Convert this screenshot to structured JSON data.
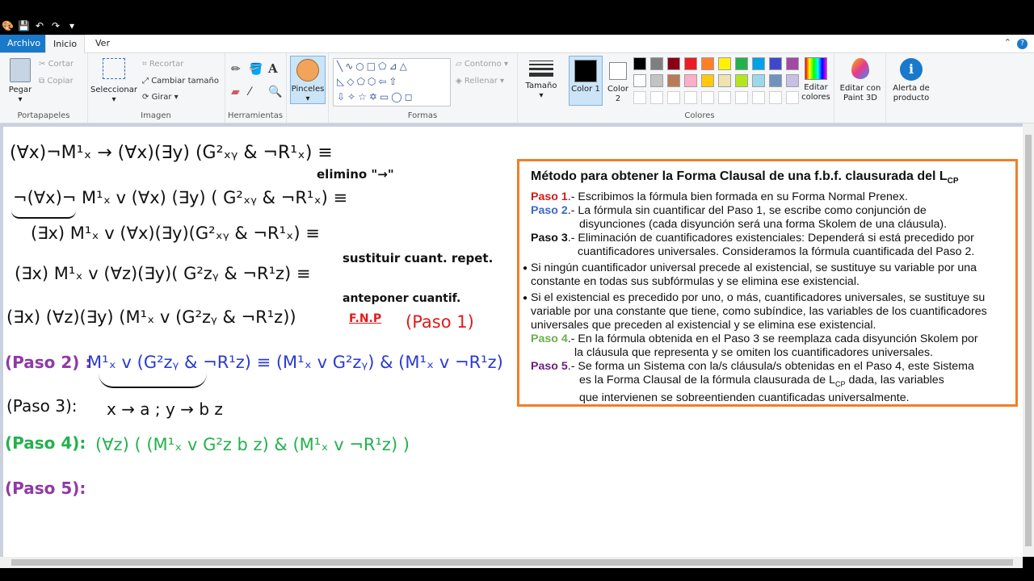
{
  "menu": {
    "file": "Archivo",
    "home": "Inicio",
    "view": "Ver"
  },
  "clipboard": {
    "paste": "Pegar",
    "cut": "Cortar",
    "copy": "Copiar",
    "label": "Portapapeles"
  },
  "image": {
    "select": "Seleccionar",
    "crop": "Recortar",
    "resize": "Cambiar tamaño",
    "rotate": "Girar",
    "label": "Imagen"
  },
  "tools": {
    "label": "Herramientas",
    "brushes": "Pinceles"
  },
  "shapes": {
    "outline": "Contorno",
    "fill": "Rellenar",
    "label": "Formas"
  },
  "size": {
    "label": "Tamaño"
  },
  "colors": {
    "color1": "Color 1",
    "color2": "Color 2",
    "edit": "Editar colores",
    "label": "Colores",
    "palette_row1": [
      "#000000",
      "#7f7f7f",
      "#880015",
      "#ed1c24",
      "#ff7f27",
      "#fff200",
      "#22b14c",
      "#00a2e8",
      "#3f48cc",
      "#a349a4"
    ],
    "palette_row2": [
      "#ffffff",
      "#c3c3c3",
      "#b97a57",
      "#ffaec9",
      "#ffc90e",
      "#efe4b0",
      "#b5e61d",
      "#99d9ea",
      "#7092be",
      "#c8bfe7"
    ]
  },
  "paint3d": {
    "label": "Editar con Paint 3D"
  },
  "alert": {
    "label": "Alerta de producto"
  },
  "handwriting": {
    "l1": "(∀x)¬M¹ₓ → (∀x)(∃y) (G²ₓᵧ & ¬R¹ₓ) ≡",
    "l1note": "elimino \"→\"",
    "l2": "¬(∀x)¬ M¹ₓ v (∀x) (∃y) ( G²ₓᵧ & ¬R¹ₓ)  ≡",
    "l3": "(∃x) M¹ₓ v (∀x)(∃y)(G²ₓᵧ & ¬R¹ₓ)  ≡",
    "l3note": "sustituir cuant. repet.",
    "l4": "(∃x) M¹ₓ  v (∀z)(∃y)( G²zᵧ  & ¬R¹z)  ≡",
    "l4note": "anteponer cuantif.",
    "l5": "(∃x) (∀z)(∃y) (M¹ₓ v (G²zᵧ  & ¬R¹z))",
    "fnp": "F.N.P",
    "paso1": "(Paso 1)",
    "paso2": "(Paso 2) :",
    "paso2expr": "M¹ₓ v (G²zᵧ & ¬R¹z) ≡ (M¹ₓ v G²zᵧ)  & (M¹ₓ v ¬R¹z)",
    "paso3": "(Paso 3):",
    "paso3expr": "x → a    ;    y → b z",
    "paso4": "(Paso 4):",
    "paso4expr": "(∀z) ( (M¹ₓ v G²z b z) & (M¹ₓ v ¬R¹z) )",
    "paso5": "(Paso 5):"
  },
  "box": {
    "title": "Método para obtener la Forma Clausal de una  f.b.f. clausurada del L",
    "title_sub": "CP",
    "p1_label": "Paso 1",
    "p1_text": ".-   Escribimos la fórmula bien formada en su Forma Normal Prenex.",
    "p2_label": "Paso 2",
    "p2_text": ".-   La fórmula sin cuantificar del Paso 1, se escribe como conjunción de",
    "p2_text2": "disyunciones (cada disyunción será una forma Skolem de una cláusula).",
    "p3_label": "Paso 3",
    "p3_text": ".- Eliminación de cuantificadores existenciales: Dependerá si está precedido por",
    "p3_text2": "cuantificadores universales. Consideramos la fórmula cuantificada del Paso 2.",
    "b1": "Si ningún cuantificador universal precede al existencial, se sustituye su variable por una constante en todas sus subfórmulas y se elimina ese existencial.",
    "b2": "Si el existencial es precedido por uno, o más, cuantificadores universales,  se sustituye su variable por una constante que tiene, como subíndice, las  variables de los cuantificadores universales que preceden  al  existencial  y se elimina ese existencial.",
    "p4_label": "Paso 4",
    "p4_text": ".- En la fórmula obtenida en el Paso 3 se reemplaza cada disyunción Skolem  por",
    "p4_text2": "la cláusula que representa y se omiten los cuantificadores universales.",
    "p5_label": "Paso 5",
    "p5_text": ".- Se forma un Sistema con  la/s  cláusula/s obtenidas en el   Paso  4,  este Sistema",
    "p5_text2": "es la  Forma Clausal  de la fórmula clausurada  de   L",
    "p5_sub": "CP",
    "p5_text2b": " dada, las variables",
    "p5_text3": "que intervienen se sobreentienden cuantificadas universalmente."
  }
}
